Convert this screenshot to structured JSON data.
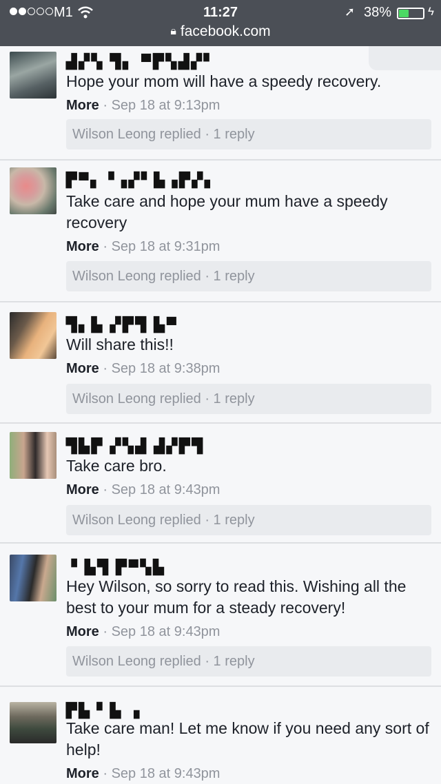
{
  "status_bar": {
    "carrier": "M1",
    "time": "11:27",
    "battery": "38%",
    "battery_level": 0.38
  },
  "browser": {
    "address": "facebook.com"
  },
  "comments": [
    {
      "name": "▟▞▚ ▜▖ ▀▛▚▟▞▘",
      "text": "Hope your mom will have a speedy recovery.",
      "more": "More",
      "timestamp": "Sep 18 at 9:13pm",
      "reply_text": "Wilson Leong replied · 1 reply"
    },
    {
      "name": "▛▀▖▝▗▞▘▙▗▛▞▖",
      "text": "Take care and hope your mum have a speedy recovery",
      "more": "More",
      "timestamp": "Sep 18 at 9:31pm",
      "reply_text": "Wilson Leong replied · 1 reply"
    },
    {
      "name": "▜▖▙ ▞▛▜ ▙▀",
      "text": "Will share this!!",
      "more": "More",
      "timestamp": "Sep 18 at 9:38pm",
      "reply_text": "Wilson Leong replied · 1 reply"
    },
    {
      "name": "▜▙▛ ▞▚▟ ▟▞▛▜",
      "text": "Take care bro.",
      "more": "More",
      "timestamp": "Sep 18 at 9:43pm",
      "reply_text": "Wilson Leong replied · 1 reply"
    },
    {
      "name": "▝ ▙▜ ▛▀▚▙",
      "text": "Hey Wilson, so sorry to read this. Wishing all the best to your mum for a steady recovery!",
      "more": "More",
      "timestamp": "Sep 18 at 9:43pm",
      "reply_text": "Wilson Leong replied · 1 reply"
    },
    {
      "name": "▛▙▝ ▙ ▗",
      "text": "Take care man! Let me know if you need any sort of help!",
      "more": "More",
      "timestamp": "Sep 18 at 9:43pm"
    }
  ]
}
